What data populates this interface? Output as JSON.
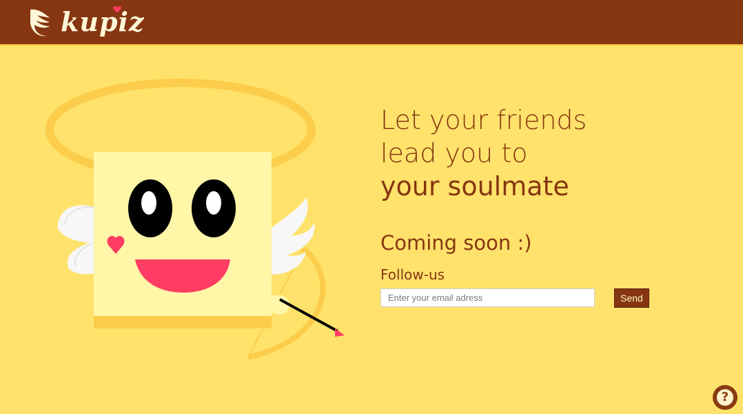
{
  "header": {
    "brand": "kupiz"
  },
  "hero": {
    "headline_lines": [
      "Let your friends",
      "lead you to"
    ],
    "headline_emphasis": "your soulmate",
    "coming_soon": "Coming soon :)",
    "follow_label": "Follow-us"
  },
  "signup": {
    "email_placeholder": "Enter your email adress",
    "send_label": "Send"
  },
  "help": {
    "icon": "question-icon",
    "glyph": "?"
  },
  "colors": {
    "background": "#ffe26b",
    "header": "#863611",
    "text_brown": "#863611",
    "heart_pink": "#ff3c63",
    "face": "#fff6a8"
  }
}
